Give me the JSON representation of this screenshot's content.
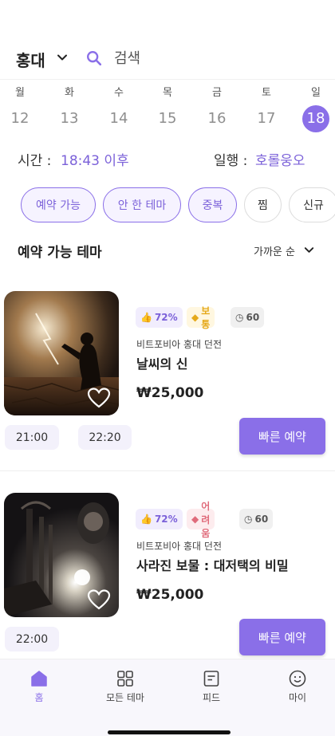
{
  "header": {
    "region": "홍대",
    "search_placeholder": "검색"
  },
  "week": [
    {
      "dow": "월",
      "date": "12",
      "selected": false
    },
    {
      "dow": "화",
      "date": "13",
      "selected": false
    },
    {
      "dow": "수",
      "date": "14",
      "selected": false
    },
    {
      "dow": "목",
      "date": "15",
      "selected": false
    },
    {
      "dow": "금",
      "date": "16",
      "selected": false
    },
    {
      "dow": "토",
      "date": "17",
      "selected": false
    },
    {
      "dow": "일",
      "date": "18",
      "selected": true
    }
  ],
  "info": {
    "time_label": "시간 :",
    "time_value": "18:43 이후",
    "party_label": "일행 :",
    "party_value": "호롤웅오"
  },
  "filters": [
    {
      "label": "예약 가능",
      "active": true
    },
    {
      "label": "안 한 테마",
      "active": true
    },
    {
      "label": "중복",
      "active": true
    },
    {
      "label": "찜",
      "active": false
    },
    {
      "label": "신규",
      "active": false
    }
  ],
  "section": {
    "title": "예약 가능 테마",
    "sort_label": "가까운 순"
  },
  "themes": [
    {
      "like_pct": "72%",
      "difficulty": "보통",
      "duration": "60",
      "store": "비트포비아 홍대 던전",
      "title": "날씨의 신",
      "price": "₩25,000",
      "slots": [
        "21:00",
        "22:20"
      ],
      "quick_label": "빠른 예약"
    },
    {
      "like_pct": "72%",
      "difficulty": "어려움",
      "duration": "60",
      "store": "비트포비아 홍대 던전",
      "title": "사라진 보물 : 대저택의 비밀",
      "price": "₩25,000",
      "slots": [
        "22:00"
      ],
      "quick_label": "빠른 예약"
    }
  ],
  "tabs": [
    {
      "label": "홈",
      "icon": "home-icon",
      "active": true
    },
    {
      "label": "모든 테마",
      "icon": "grid-icon",
      "active": false
    },
    {
      "label": "피드",
      "icon": "feed-icon",
      "active": false
    },
    {
      "label": "마이",
      "icon": "smile-icon",
      "active": false
    }
  ],
  "colors": {
    "accent": "#8a6fe8",
    "accent_text": "#7b61d9"
  }
}
